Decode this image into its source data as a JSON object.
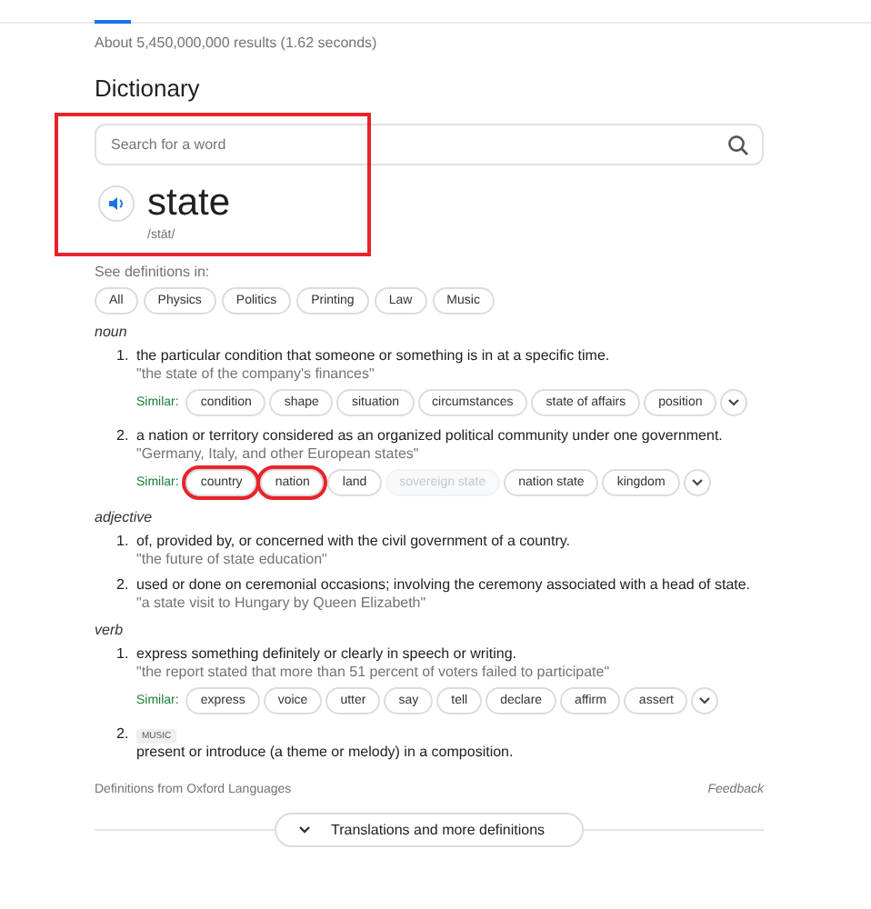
{
  "results_stats": "About 5,450,000,000 results (1.62 seconds)",
  "heading": "Dictionary",
  "search": {
    "placeholder": "Search for a word"
  },
  "entry": {
    "word": "state",
    "pronunciation": "/stāt/",
    "highlighted": true
  },
  "domains_label": "See definitions in:",
  "domains": [
    {
      "label": "All"
    },
    {
      "label": "Physics"
    },
    {
      "label": "Politics"
    },
    {
      "label": "Printing"
    },
    {
      "label": "Law"
    },
    {
      "label": "Music"
    }
  ],
  "senses": [
    {
      "pos": "noun",
      "definitions": [
        {
          "number": "1.",
          "text": "the particular condition that someone or something is in at a specific time.",
          "example": "\"the state of the company's finances\"",
          "similar_label": "Similar:",
          "similar": [
            {
              "word": "condition",
              "highlighted": false,
              "disabled": false
            },
            {
              "word": "shape",
              "highlighted": false,
              "disabled": false
            },
            {
              "word": "situation",
              "highlighted": false,
              "disabled": false
            },
            {
              "word": "circumstances",
              "highlighted": false,
              "disabled": false
            },
            {
              "word": "state of affairs",
              "highlighted": false,
              "disabled": false
            },
            {
              "word": "position",
              "highlighted": false,
              "disabled": false
            }
          ]
        },
        {
          "number": "2.",
          "text": "a nation or territory considered as an organized political community under one government.",
          "example": "\"Germany, Italy, and other European states\"",
          "similar_label": "Similar:",
          "similar": [
            {
              "word": "country",
              "highlighted": true,
              "disabled": false
            },
            {
              "word": "nation",
              "highlighted": true,
              "disabled": false
            },
            {
              "word": "land",
              "highlighted": false,
              "disabled": false
            },
            {
              "word": "sovereign state",
              "highlighted": false,
              "disabled": true
            },
            {
              "word": "nation state",
              "highlighted": false,
              "disabled": false
            },
            {
              "word": "kingdom",
              "highlighted": false,
              "disabled": false
            }
          ]
        }
      ]
    },
    {
      "pos": "adjective",
      "definitions": [
        {
          "number": "1.",
          "text": "of, provided by, or concerned with the civil government of a country.",
          "example": "\"the future of state education\""
        },
        {
          "number": "2.",
          "text": "used or done on ceremonial occasions; involving the ceremony associated with a head of state.",
          "example": "\"a state visit to Hungary by Queen Elizabeth\""
        }
      ]
    },
    {
      "pos": "verb",
      "definitions": [
        {
          "number": "1.",
          "text": "express something definitely or clearly in speech or writing.",
          "example": "\"the report stated that more than 51 percent of voters failed to participate\"",
          "similar_label": "Similar:",
          "similar": [
            {
              "word": "express",
              "highlighted": false,
              "disabled": false
            },
            {
              "word": "voice",
              "highlighted": false,
              "disabled": false
            },
            {
              "word": "utter",
              "highlighted": false,
              "disabled": false
            },
            {
              "word": "say",
              "highlighted": false,
              "disabled": false
            },
            {
              "word": "tell",
              "highlighted": false,
              "disabled": false
            },
            {
              "word": "declare",
              "highlighted": false,
              "disabled": false
            },
            {
              "word": "affirm",
              "highlighted": false,
              "disabled": false
            },
            {
              "word": "assert",
              "highlighted": false,
              "disabled": false
            }
          ]
        },
        {
          "number": "2.",
          "label": "MUSIC",
          "text": "present or introduce (a theme or melody) in a composition."
        }
      ]
    }
  ],
  "source": "Definitions from Oxford Languages",
  "feedback": "Feedback",
  "more_button": "Translations and more definitions"
}
